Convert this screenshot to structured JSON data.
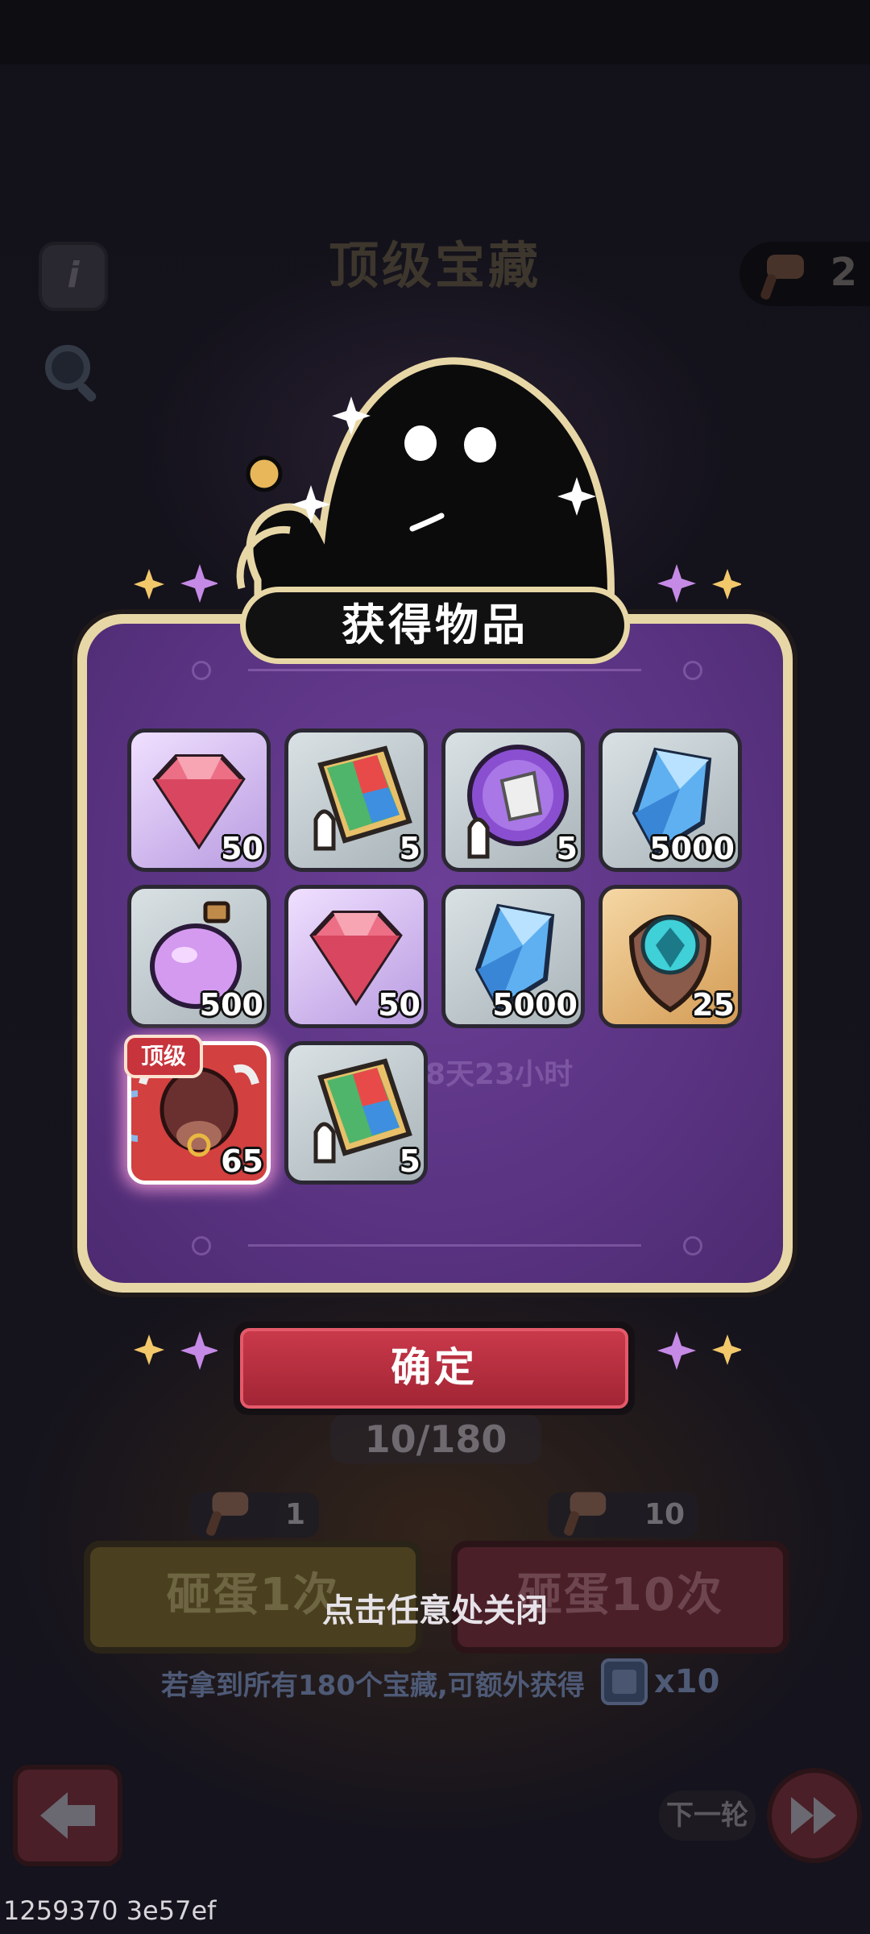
{
  "background": {
    "title": "顶级宝藏",
    "info_icon": "i",
    "hammer_count": "2",
    "progress": "10/180",
    "cost_single": "1",
    "cost_ten": "10",
    "smash_once": "砸蛋1次",
    "smash_ten": "砸蛋10次",
    "bonus_text": "若拿到所有180个宝藏,可额外获得",
    "bonus_qty": "x10",
    "next_round": "下一轮",
    "timer_ghost": "8天23小时"
  },
  "dialog": {
    "title": "获得物品",
    "tier_tag": "顶级",
    "items": [
      {
        "icon": "pink-gem-icon",
        "qty": "50",
        "frame": "purple"
      },
      {
        "icon": "skill-book-icon",
        "qty": "5",
        "frame": "grey"
      },
      {
        "icon": "equipment-orb-icon",
        "qty": "5",
        "frame": "grey"
      },
      {
        "icon": "blue-crystal-icon",
        "qty": "5000",
        "frame": "grey"
      },
      {
        "icon": "potion-bottle-icon",
        "qty": "500",
        "frame": "grey"
      },
      {
        "icon": "pink-gem-icon",
        "qty": "50",
        "frame": "purple"
      },
      {
        "icon": "blue-crystal-icon",
        "qty": "5000",
        "frame": "grey"
      },
      {
        "icon": "teal-emblem-icon",
        "qty": "25",
        "frame": "gold"
      },
      {
        "icon": "bull-hero-icon",
        "qty": "65",
        "frame": "red"
      },
      {
        "icon": "skill-book-icon",
        "qty": "5",
        "frame": "grey"
      }
    ],
    "confirm_label": "确定",
    "close_hint": "点击任意处关闭"
  },
  "build_id": "1259370 3e57ef",
  "colors": {
    "panel_purple": "#5a3382",
    "panel_border": "#e8d7a6",
    "confirm_red": "#b52d3f"
  }
}
